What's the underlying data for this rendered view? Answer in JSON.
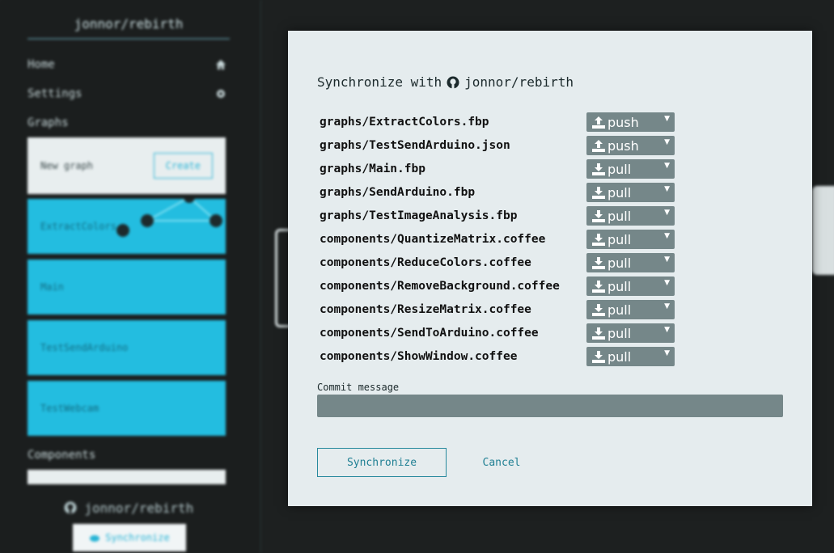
{
  "sidebar": {
    "title": "jonnor/rebirth",
    "links": [
      {
        "label": "Home",
        "icon": "home-icon"
      },
      {
        "label": "Settings",
        "icon": "gear-icon"
      }
    ],
    "graphs_heading": "Graphs",
    "new_graph_placeholder": "New graph",
    "create_label": "Create",
    "graphs": [
      "ExtractColors",
      "Main",
      "TestSendArduino",
      "TestWebcam"
    ],
    "components_heading": "Components",
    "repo": "jonnor/rebirth",
    "sync_label": "Synchronize"
  },
  "modal": {
    "title_prefix": "Synchronize with",
    "repo": "jonnor/rebirth",
    "files": [
      {
        "name": "graphs/ExtractColors.fbp",
        "action": "push",
        "icon": "upload-icon"
      },
      {
        "name": "graphs/TestSendArduino.json",
        "action": "push",
        "icon": "upload-icon"
      },
      {
        "name": "graphs/Main.fbp",
        "action": "pull",
        "icon": "download-icon"
      },
      {
        "name": "graphs/SendArduino.fbp",
        "action": "pull",
        "icon": "download-icon"
      },
      {
        "name": "graphs/TestImageAnalysis.fbp",
        "action": "pull",
        "icon": "download-icon"
      },
      {
        "name": "components/QuantizeMatrix.coffee",
        "action": "pull",
        "icon": "download-icon"
      },
      {
        "name": "components/ReduceColors.coffee",
        "action": "pull",
        "icon": "download-icon"
      },
      {
        "name": "components/RemoveBackground.coffee",
        "action": "pull",
        "icon": "download-icon"
      },
      {
        "name": "components/ResizeMatrix.coffee",
        "action": "pull",
        "icon": "download-icon"
      },
      {
        "name": "components/SendToArduino.coffee",
        "action": "pull",
        "icon": "download-icon"
      },
      {
        "name": "components/ShowWindow.coffee",
        "action": "pull",
        "icon": "download-icon"
      }
    ],
    "commit_label": "Commit message",
    "commit_value": "",
    "sync_button": "Synchronize",
    "cancel_button": "Cancel"
  },
  "colors": {
    "accent": "#23bde0",
    "select_bg": "#758789",
    "modal_bg": "#e5ecee"
  }
}
